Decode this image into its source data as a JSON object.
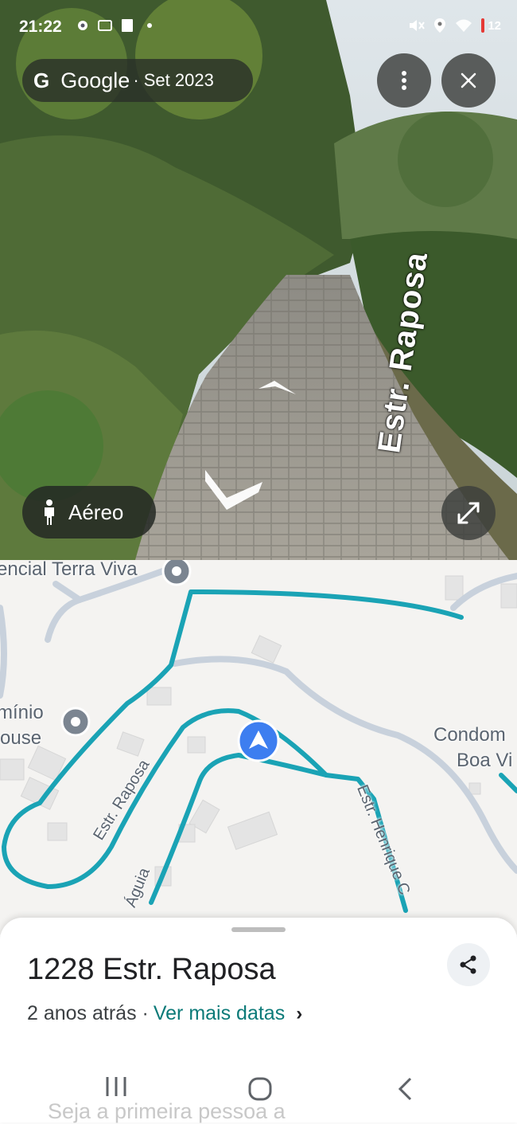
{
  "status_bar": {
    "time": "21:22",
    "battery": "12"
  },
  "street_view": {
    "brand": "Google",
    "date": "· Set 2023",
    "street_label": "Estr. Raposa",
    "aereo_label": "Aéreo"
  },
  "map": {
    "labels": {
      "terra_viva": "encial Terra Viva",
      "dominio_1": "mínio",
      "dominio_2": "ouse",
      "condom_1": "Condom",
      "condom_2": "Boa Vi",
      "raposa": "Estr. Raposa",
      "henrique": "Estr. Henrique C",
      "aguia": "Águia"
    }
  },
  "sheet": {
    "address": "1228 Estr. Raposa",
    "age": "2 anos atrás ·",
    "more_dates": "Ver mais datas",
    "ghost_text": "Seja a primeira pessoa a"
  },
  "colors": {
    "route": "#1aa3b5",
    "accent_link": "#0b7a78",
    "my_location": "#3d7ef0"
  }
}
